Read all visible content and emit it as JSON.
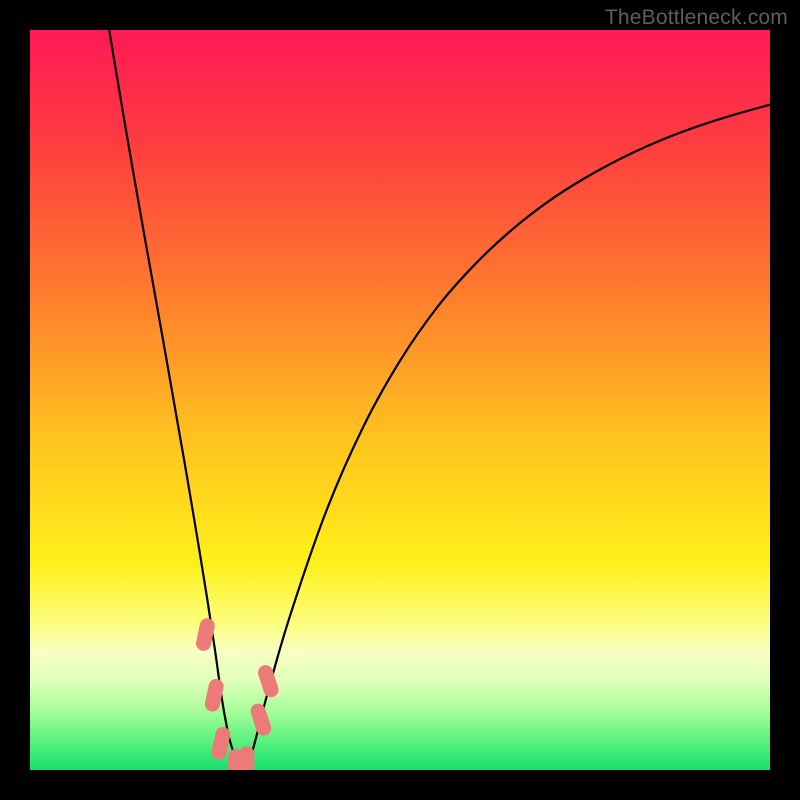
{
  "watermark": {
    "text": "TheBottleneck.com"
  },
  "chart_data": {
    "type": "line",
    "title": "",
    "xlabel": "",
    "ylabel": "",
    "xlim": [
      0,
      100
    ],
    "ylim": [
      0,
      100
    ],
    "grid": false,
    "legend": false,
    "background": {
      "type": "vertical-gradient",
      "stops": [
        {
          "pos": 0.0,
          "color": "#ff1a57"
        },
        {
          "pos": 0.15,
          "color": "#ff3b3f"
        },
        {
          "pos": 0.35,
          "color": "#ff7a2e"
        },
        {
          "pos": 0.55,
          "color": "#ffc21f"
        },
        {
          "pos": 0.72,
          "color": "#fff01a"
        },
        {
          "pos": 0.8,
          "color": "#fdfe7c"
        },
        {
          "pos": 0.84,
          "color": "#f7ffc4"
        },
        {
          "pos": 0.88,
          "color": "#dfffb8"
        },
        {
          "pos": 0.92,
          "color": "#a7ff9a"
        },
        {
          "pos": 0.96,
          "color": "#5cf17f"
        },
        {
          "pos": 1.0,
          "color": "#15e06b"
        }
      ]
    },
    "series": [
      {
        "name": "bottleneck-curve",
        "color": "#000000",
        "x": [
          10.7,
          12,
          13,
          14,
          15,
          16,
          17,
          18,
          19,
          20,
          21,
          22,
          23,
          24,
          25,
          26,
          27,
          28,
          28.8,
          30,
          32,
          35,
          40,
          45,
          50,
          55,
          60,
          65,
          70,
          75,
          80,
          85,
          90,
          95,
          100
        ],
        "y": [
          100,
          92.2,
          86.3,
          80.5,
          74.8,
          69.2,
          63.6,
          58.0,
          52.3,
          46.6,
          40.9,
          35.0,
          29.0,
          22.8,
          16.2,
          9.2,
          4.0,
          1.2,
          0.0,
          2.4,
          10.0,
          20.4,
          34.9,
          46.3,
          55.3,
          62.5,
          68.2,
          72.9,
          76.8,
          80.0,
          82.7,
          85.0,
          86.9,
          88.5,
          89.9
        ]
      }
    ],
    "markers": [
      {
        "x": 23.7,
        "y": 18.3,
        "color": "#eb7a78"
      },
      {
        "x": 24.9,
        "y": 10.1,
        "color": "#eb7a78"
      },
      {
        "x": 25.8,
        "y": 3.6,
        "color": "#eb7a78"
      },
      {
        "x": 27.8,
        "y": 0.6,
        "color": "#eb7a78"
      },
      {
        "x": 29.3,
        "y": 1.0,
        "color": "#eb7a78"
      },
      {
        "x": 31.2,
        "y": 6.8,
        "color": "#eb7a78"
      },
      {
        "x": 32.2,
        "y": 12.0,
        "color": "#eb7a78"
      }
    ],
    "notch": {
      "x": 28.8,
      "y": 0
    }
  }
}
